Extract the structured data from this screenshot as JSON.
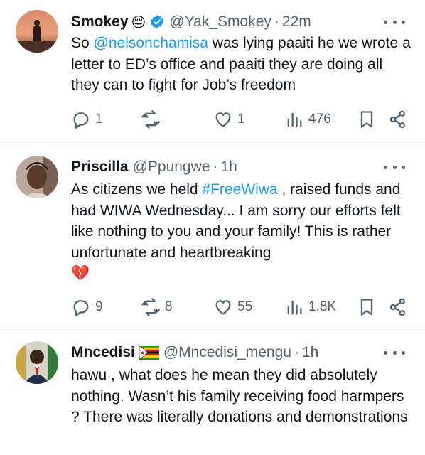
{
  "tweets": [
    {
      "name": "Smokey",
      "name_emoji": "😔",
      "verified": true,
      "handle": "@Yak_Smokey",
      "time": "22m",
      "text_pre": "So ",
      "mention": "@nelsonchamisa",
      "text_post": " was lying paaiti he we wrote a letter to ED’s office and paaiti they are doing all they can to fight for Job’s freedom",
      "replies": "1",
      "retweets": "",
      "likes": "1",
      "views": "476"
    },
    {
      "name": "Priscilla",
      "handle": "@Ppungwe",
      "time": "1h",
      "text_pre": "As citizens we held ",
      "hashtag": "#FreeWiwa",
      "text_post": " , raised funds and had WIWA Wednesday... I am sorry our efforts felt like nothing to you and your family! This is rather unfortunate and heartbreaking",
      "trailing_emoji": "💔",
      "replies": "9",
      "retweets": "8",
      "likes": "55",
      "views": "1.8K"
    },
    {
      "name": "Mncedisi",
      "name_flag": "🇿🇼",
      "handle": "@Mncedisi_mengu",
      "time": "1h",
      "text": "hawu , what does he mean they did absolutely nothing. Wasn’t his family receiving food harmpers ? There was literally donations and demonstrations"
    }
  ],
  "separator": "·",
  "colors": {
    "link": "#1d9bf0",
    "verified": "#1d9bf0",
    "muted": "#536471",
    "text": "#0f1419"
  }
}
